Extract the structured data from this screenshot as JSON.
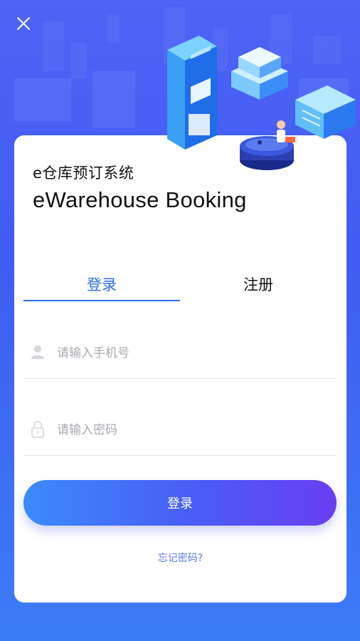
{
  "header": {
    "close_icon": "close-icon"
  },
  "app": {
    "subtitle": "e仓库预订系统",
    "title": "eWarehouse Booking"
  },
  "tabs": [
    {
      "label": "登录",
      "active": true
    },
    {
      "label": "注册",
      "active": false
    }
  ],
  "form": {
    "phone": {
      "placeholder": "请输入手机号",
      "value": "",
      "icon": "user-icon"
    },
    "password": {
      "placeholder": "请输入密码",
      "value": "",
      "icon": "lock-icon"
    },
    "submit_label": "登录",
    "forgot_label": "忘记密码?"
  },
  "colors": {
    "background": "#4f63f6",
    "accent": "#2f6cf1",
    "button_gradient_start": "#3a8bfb",
    "button_gradient_end": "#6a3ef3",
    "link": "#5b7be9"
  }
}
